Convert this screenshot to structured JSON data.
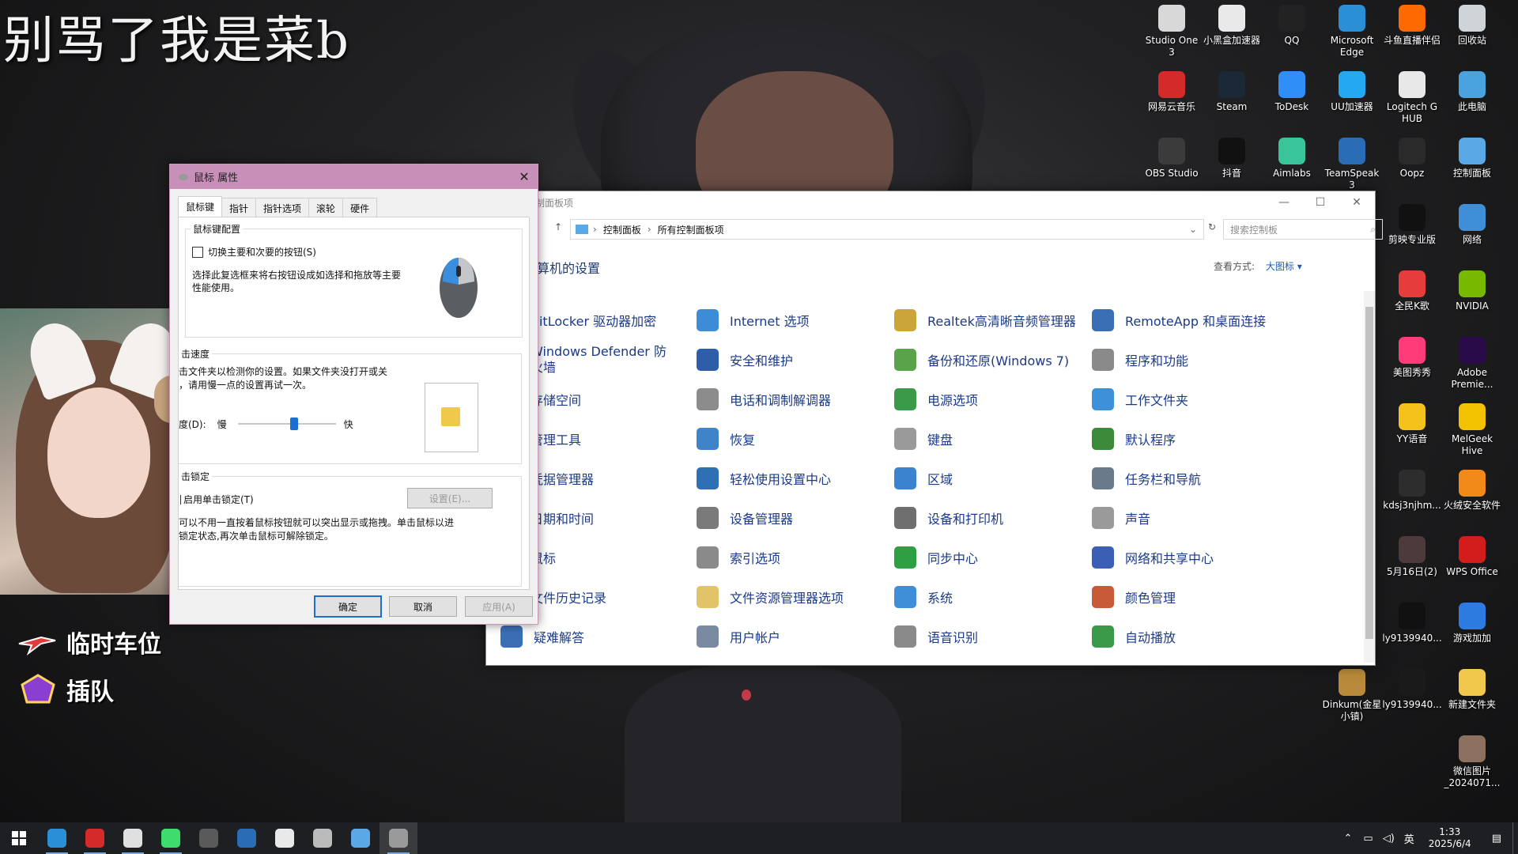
{
  "overlay": {
    "title": "别骂了我是菜b",
    "slot_line1": "临时车位",
    "slot_line2": "插队"
  },
  "desktop_icons": [
    {
      "label": "Studio One 3",
      "color": "#d8d8d8"
    },
    {
      "label": "小黑盒加速器",
      "color": "#e9e9e9"
    },
    {
      "label": "QQ",
      "color": "#222"
    },
    {
      "label": "Microsoft Edge",
      "color": "#2b8fd6"
    },
    {
      "label": "斗鱼直播伴侣",
      "color": "#ff6a00"
    },
    {
      "label": "回收站",
      "color": "#cfd4d8"
    },
    {
      "label": "网易云音乐",
      "color": "#d52a2a"
    },
    {
      "label": "Steam",
      "color": "#1b2838"
    },
    {
      "label": "ToDesk",
      "color": "#2f8ef7"
    },
    {
      "label": "UU加速器",
      "color": "#23a9f2"
    },
    {
      "label": "Logitech G HUB",
      "color": "#e8e8e8"
    },
    {
      "label": "此电脑",
      "color": "#4aa3df"
    },
    {
      "label": "OBS Studio",
      "color": "#3b3b3b"
    },
    {
      "label": "抖音",
      "color": "#111"
    },
    {
      "label": "Aimlabs",
      "color": "#3ac49a"
    },
    {
      "label": "TeamSpeak 3",
      "color": "#2a6db5"
    },
    {
      "label": "Oopz",
      "color": "#2a2a2a"
    },
    {
      "label": "控制面板",
      "color": "#5aa8e6"
    },
    {
      "label": "剪映专业版",
      "color": "#111"
    },
    {
      "label": "网络",
      "color": "#3f8fd8"
    },
    {
      "label": "全民K歌",
      "color": "#e63c3c"
    },
    {
      "label": "NVIDIA",
      "color": "#76b900"
    },
    {
      "label": "美图秀秀",
      "color": "#ff3b7a"
    },
    {
      "label": "Adobe Premie...",
      "color": "#2a0b4a"
    },
    {
      "label": "YY语音",
      "color": "#f4c21b"
    },
    {
      "label": "MelGeek Hive",
      "color": "#f2c200"
    },
    {
      "label": "kdsj3njhm...",
      "color": "#2d2d2d"
    },
    {
      "label": "火绒安全软件",
      "color": "#f28a1a"
    },
    {
      "label": "5月16日(2)",
      "color": "#4d3a3a"
    },
    {
      "label": "WPS Office",
      "color": "#d31d1d"
    },
    {
      "label": "ly9139940...",
      "color": "#111"
    },
    {
      "label": "游戏加加",
      "color": "#2b7be0"
    },
    {
      "label": "Dinkum(金星小镇)",
      "color": "#b88a3a"
    },
    {
      "label": "ly9139940...",
      "color": "#1a1a1a"
    },
    {
      "label": "新建文件夹",
      "color": "#f1c84b"
    },
    {
      "label": "微信图片_2024071...",
      "color": "#8d7060"
    }
  ],
  "mouse_dialog": {
    "title": "鼠标 属性",
    "tabs": [
      "鼠标键",
      "指针",
      "指针选项",
      "滚轮",
      "硬件"
    ],
    "group_buttons": {
      "legend": "鼠标键配置",
      "checkbox_label": "切换主要和次要的按钮(S)",
      "description": "选择此复选框来将右按钮设成如选择和拖放等主要性能使用。"
    },
    "group_speed": {
      "legend": "击速度",
      "description_line1": "击文件夹以检测你的设置。如果文件夹没打开或关",
      "description_line2": "，请用慢一点的设置再试一次。",
      "speed_label": "度(D):",
      "slow": "慢",
      "fast": "快",
      "speed_value": 0.58
    },
    "group_lock": {
      "legend": "击锁定",
      "checkbox_label": "启用单击锁定(T)",
      "settings_button": "设置(E)...",
      "description_line1": "可以不用一直按着鼠标按钮就可以突出显示或拖拽。单击鼠标以进",
      "description_line2": "锁定状态,再次单击鼠标可解除锁定。"
    },
    "ok": "确定",
    "cancel": "取消",
    "apply": "应用(A)"
  },
  "control_panel": {
    "title": "制面板项",
    "breadcrumb": [
      "控制面板",
      "所有控制面板项"
    ],
    "search_placeholder": "搜索控制板",
    "heading": "算机的设置",
    "view_by_label": "查看方式:",
    "view_by_value": "大图标 ▾",
    "items": [
      [
        "BitLocker 驱动器加密",
        "Internet 选项",
        "Realtek高清晰音频管理器",
        "RemoteApp 和桌面连接"
      ],
      [
        "Windows Defender 防火墙",
        "安全和维护",
        "备份和还原(Windows 7)",
        "程序和功能"
      ],
      [
        "存储空间",
        "电话和调制解调器",
        "电源选项",
        "工作文件夹"
      ],
      [
        "管理工具",
        "恢复",
        "键盘",
        "默认程序"
      ],
      [
        "凭据管理器",
        "轻松使用设置中心",
        "区域",
        "任务栏和导航"
      ],
      [
        "日期和时间",
        "设备管理器",
        "设备和打印机",
        "声音"
      ],
      [
        "鼠标",
        "索引选项",
        "同步中心",
        "网络和共享中心"
      ],
      [
        "文件历史记录",
        "文件资源管理器选项",
        "系统",
        "颜色管理"
      ],
      [
        "疑难解答",
        "用户帐户",
        "语音识别",
        "自动播放"
      ]
    ],
    "item_colors": [
      [
        "#9aa3ad",
        "#3d8dd6",
        "#c9a53a",
        "#3b6fb5"
      ],
      [
        "#4b7fbd",
        "#2e5ea8",
        "#5aa34b",
        "#8a8a8a"
      ],
      [
        "#6f7e8d",
        "#8c8c8c",
        "#3b9a4a",
        "#3e90d8"
      ],
      [
        "#7d7d7d",
        "#3f84c8",
        "#9a9a9a",
        "#3a8a3a"
      ],
      [
        "#b38a3a",
        "#2f6fb3",
        "#3b82cf",
        "#6a7a8a"
      ],
      [
        "#6a8ab0",
        "#7a7a7a",
        "#6f6f6f",
        "#9a9a9a"
      ],
      [
        "#9a9a9a",
        "#8a8a8a",
        "#2ea043",
        "#3b5fb5"
      ],
      [
        "#d4a23a",
        "#e3c36a",
        "#3f8fd8",
        "#c85a3a"
      ],
      [
        "#3b6fb5",
        "#7a8aa0",
        "#8a8a8a",
        "#3a9a4a"
      ]
    ]
  },
  "taskbar": {
    "apps": [
      {
        "name": "edge",
        "color": "#2b8fd6"
      },
      {
        "name": "netease-music",
        "color": "#d52a2a"
      },
      {
        "name": "studio-one",
        "color": "#e0e0e0"
      },
      {
        "name": "kook",
        "color": "#3ddc6d"
      },
      {
        "name": "obs",
        "color": "#5a5a5a"
      },
      {
        "name": "teamspeak",
        "color": "#2a6db5"
      },
      {
        "name": "xiaoheihe",
        "color": "#e9e9e9"
      },
      {
        "name": "panda",
        "color": "#bbbbbb"
      },
      {
        "name": "control-panel",
        "color": "#5aa8e6"
      },
      {
        "name": "mouse",
        "color": "#9a9a9a"
      }
    ],
    "ime": "英",
    "time": "1:33",
    "date": "2025/6/4"
  }
}
